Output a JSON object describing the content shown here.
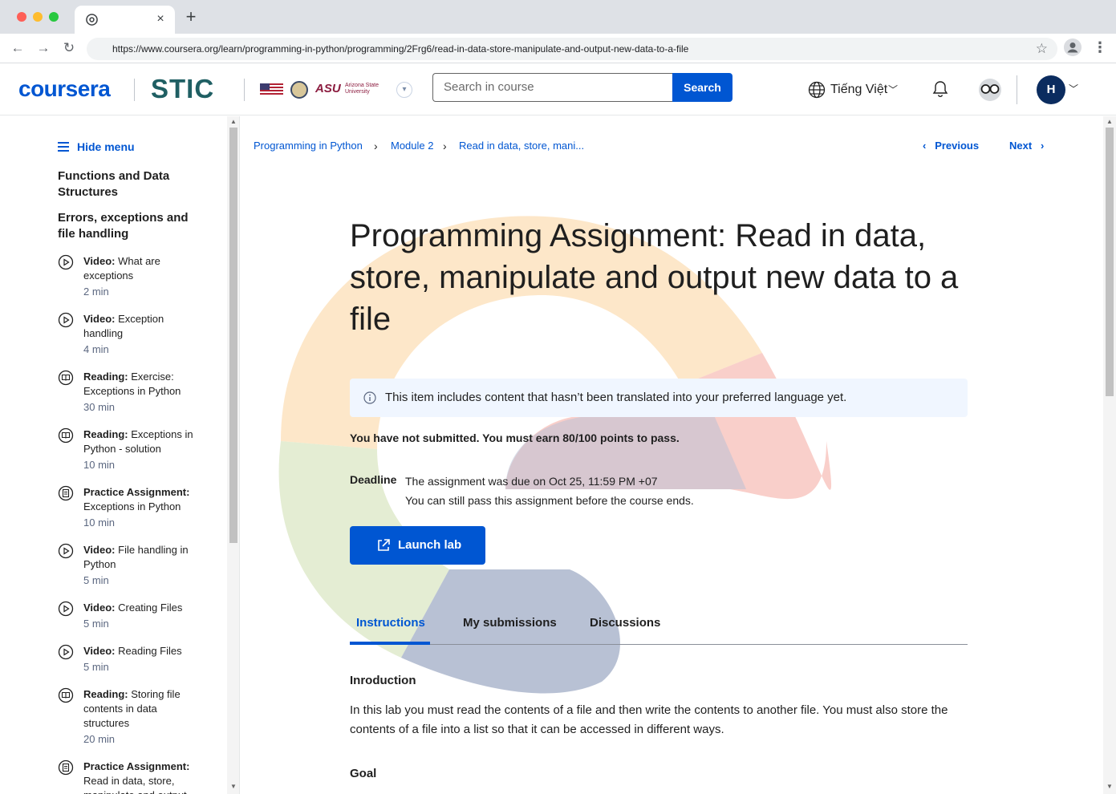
{
  "browser": {
    "url": "https://www.coursera.org/learn/programming-in-python/programming/2Frg6/read-in-data-store-manipulate-and-output-new-data-to-a-file",
    "tab_close": "×",
    "new_tab": "+"
  },
  "header": {
    "logo": "coursera",
    "partner_logo": "STIC",
    "partner_asu": "ASU",
    "partner_asu_small": "Arizona State University",
    "search_placeholder": "Search in course",
    "search_button": "Search",
    "language": "Tiếng Việt",
    "avatar_initial": "H"
  },
  "sidebar": {
    "hide_menu": "Hide menu",
    "sections": [
      "Functions and Data Structures",
      "Errors, exceptions and file handling"
    ],
    "items": [
      {
        "type": "Video:",
        "title": "What are exceptions",
        "duration": "2 min",
        "icon": "play-circle-icon"
      },
      {
        "type": "Video:",
        "title": "Exception handling",
        "duration": "4 min",
        "icon": "play-circle-icon"
      },
      {
        "type": "Reading:",
        "title": "Exercise: Exceptions in Python",
        "duration": "30 min",
        "icon": "book-icon"
      },
      {
        "type": "Reading:",
        "title": "Exceptions in Python - solution",
        "duration": "10 min",
        "icon": "book-icon"
      },
      {
        "type": "Practice Assignment:",
        "title": "Exceptions in Python",
        "duration": "10 min",
        "icon": "assignment-icon"
      },
      {
        "type": "Video:",
        "title": "File handling in Python",
        "duration": "5 min",
        "icon": "play-circle-icon"
      },
      {
        "type": "Video:",
        "title": "Creating Files",
        "duration": "5 min",
        "icon": "play-circle-icon"
      },
      {
        "type": "Video:",
        "title": "Reading Files",
        "duration": "5 min",
        "icon": "play-circle-icon"
      },
      {
        "type": "Reading:",
        "title": "Storing file contents in data structures",
        "duration": "20 min",
        "icon": "book-icon"
      },
      {
        "type": "Practice Assignment:",
        "title": "Read in data, store, manipulate and output",
        "duration": "",
        "icon": "assignment-icon"
      }
    ]
  },
  "breadcrumb": [
    "Programming in Python",
    "Module 2",
    "Read in data, store, mani..."
  ],
  "nav": {
    "previous": "Previous",
    "next": "Next"
  },
  "main": {
    "title": "Programming Assignment: Read in data, store, manipulate and output new data to a file",
    "info_banner": "This item includes content that hasn’t been translated into your preferred language yet.",
    "status": "You have not submitted. You must earn 80/100 points to pass.",
    "deadline_label": "Deadline",
    "deadline_line1": "The assignment was due on Oct 25, 11:59 PM +07",
    "deadline_line2": "You can still pass this assignment before the course ends.",
    "launch_button": "Launch lab",
    "tabs": [
      "Instructions",
      "My submissions",
      "Discussions"
    ],
    "active_tab": "Instructions",
    "intro_heading": "Inroduction",
    "intro_text": "In this lab you must read the contents of a file and then write the contents to another file. You must also store the contents of a file into a list so that it can be accessed in different ways.",
    "goal_heading": "Goal"
  },
  "colors": {
    "accent": "#0056d2",
    "stic": "#1f5f63",
    "asu": "#8c1d40",
    "avatar": "#0b2c5f",
    "banner": "#f0f6ff"
  }
}
